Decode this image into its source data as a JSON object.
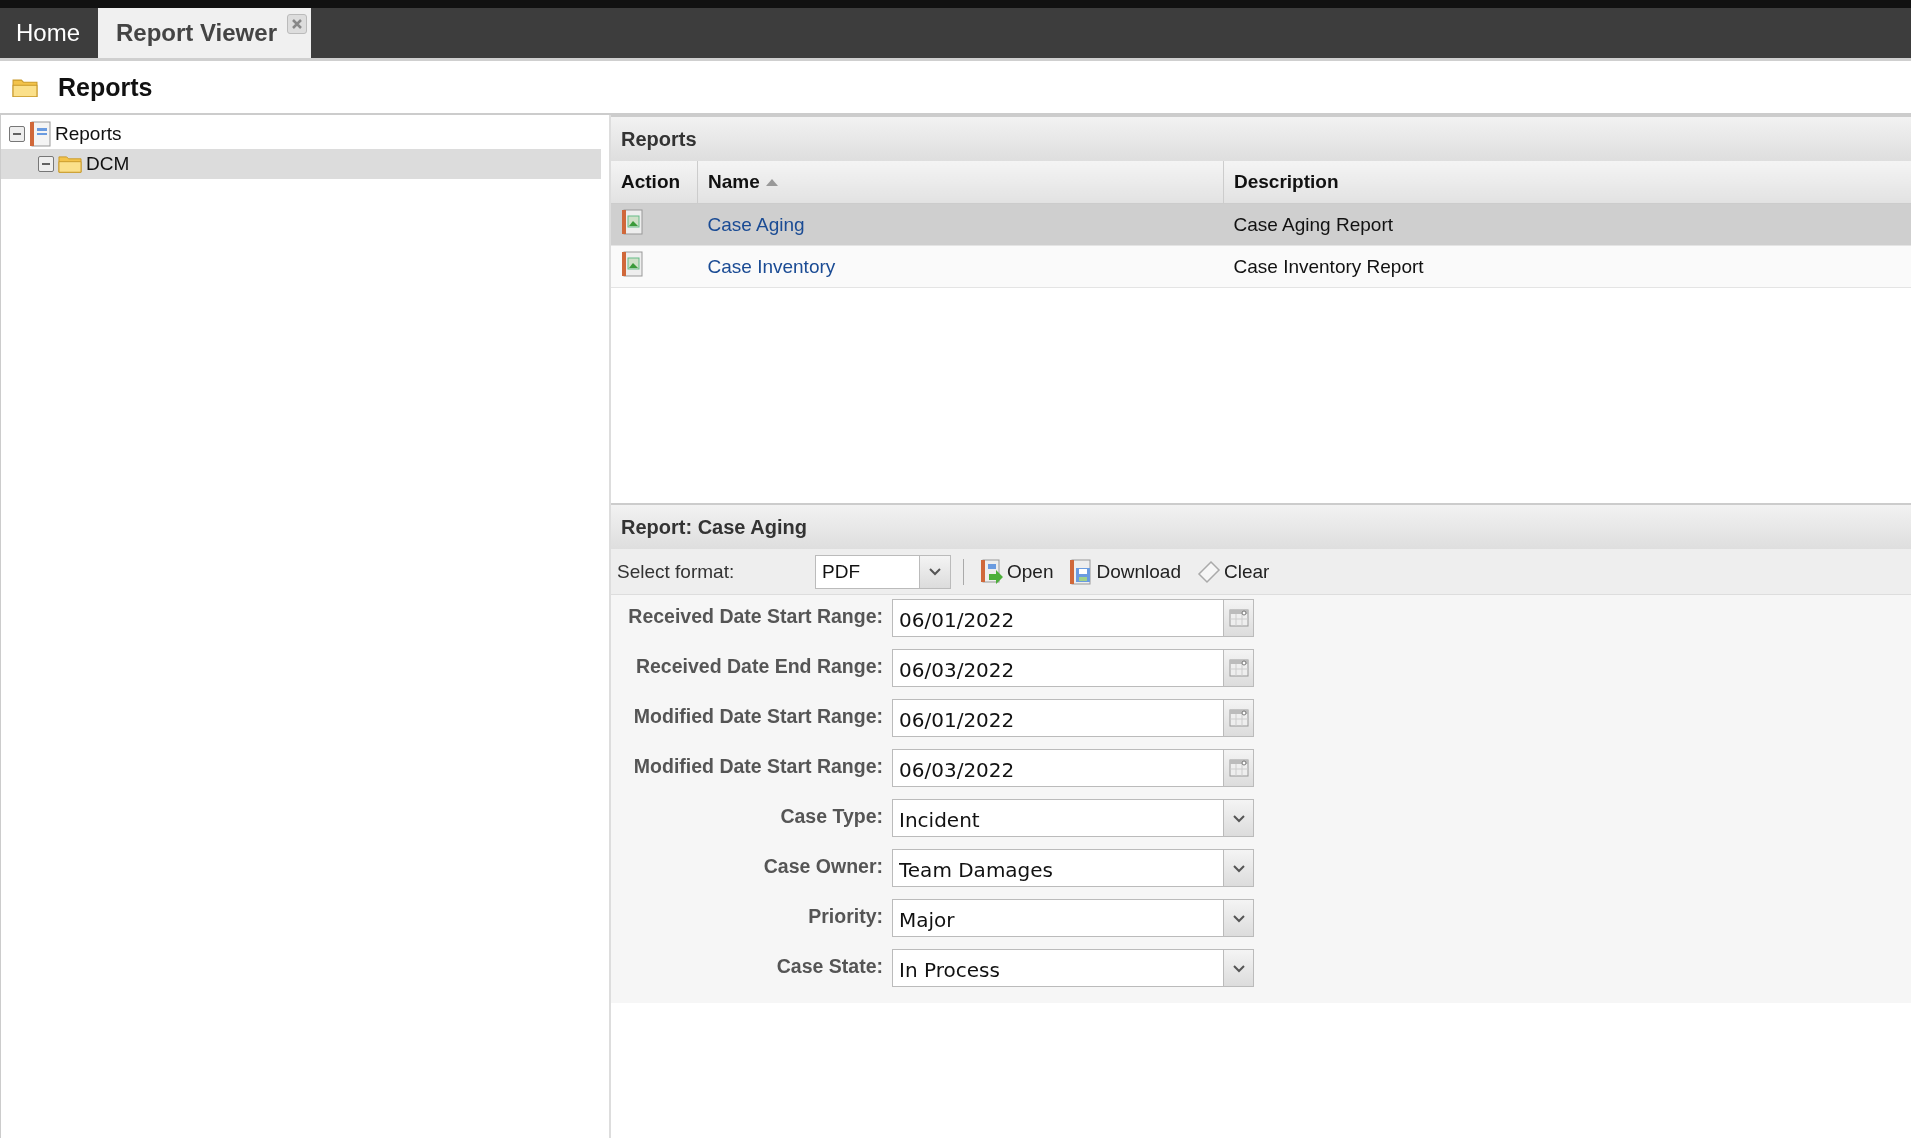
{
  "tabs": [
    {
      "label": "Home",
      "selected": false,
      "closable": false
    },
    {
      "label": "Report Viewer",
      "selected": true,
      "closable": true
    }
  ],
  "page_title": "Reports",
  "tree": [
    {
      "label": "Reports",
      "kind": "reports",
      "expanded": true,
      "selected": false,
      "children": [
        {
          "label": "DCM",
          "kind": "folder",
          "expanded": true,
          "selected": true
        }
      ]
    }
  ],
  "reports_panel": {
    "title": "Reports",
    "columns": [
      {
        "label": "Action",
        "sorted": false
      },
      {
        "label": "Name",
        "sorted": true
      },
      {
        "label": "Description",
        "sorted": false
      }
    ],
    "rows": [
      {
        "name": "Case Aging",
        "description": "Case Aging Report",
        "selected": true
      },
      {
        "name": "Case Inventory",
        "description": "Case Inventory Report",
        "selected": false
      }
    ]
  },
  "report_form": {
    "title": "Report: Case Aging",
    "format_label": "Select format:",
    "format": "PDF",
    "actions": [
      {
        "label": "Open",
        "kind": "open",
        "disabled": false
      },
      {
        "label": "Download",
        "kind": "download",
        "disabled": false
      },
      {
        "label": "Clear",
        "kind": "clear",
        "disabled": false
      }
    ],
    "fields": [
      {
        "label": "Received Date Start Range:",
        "kind": "date",
        "value": "06/01/2022"
      },
      {
        "label": "Received Date End Range:",
        "kind": "date",
        "value": "06/03/2022"
      },
      {
        "label": "Modified Date Start Range:",
        "kind": "date",
        "value": "06/01/2022"
      },
      {
        "label": "Modified Date Start Range:",
        "kind": "date",
        "value": "06/03/2022"
      },
      {
        "label": "Case Type:",
        "kind": "select",
        "value": "Incident"
      },
      {
        "label": "Case Owner:",
        "kind": "select",
        "value": "Team Damages"
      },
      {
        "label": "Priority:",
        "kind": "select",
        "value": "Major"
      },
      {
        "label": "Case State:",
        "kind": "select",
        "value": "In Process"
      }
    ]
  }
}
